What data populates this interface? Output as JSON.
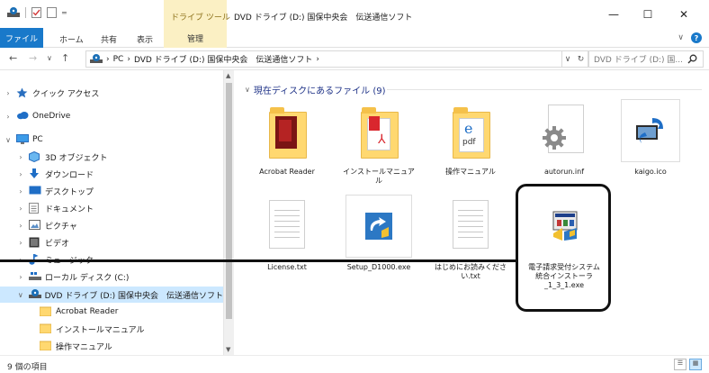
{
  "titlebar": {
    "context_tab_label": "ドライブ ツール",
    "window_title": "DVD ドライブ (D:) 国保中央会　伝送通信ソフト",
    "minimize": "—",
    "maximize": "☐",
    "close": "✕"
  },
  "ribbon": {
    "file_label": "ファイル",
    "home_label": "ホーム",
    "share_label": "共有",
    "view_label": "表示",
    "manage_label": "管理",
    "expand_glyph": "∨",
    "help_glyph": "?"
  },
  "address": {
    "back": "←",
    "forward": "→",
    "recent": "∨",
    "up": "↑",
    "crumbs": [
      "PC",
      "DVD ドライブ (D:) 国保中央会　伝送通信ソフト"
    ],
    "sep": "›",
    "dropdown": "∨",
    "refresh": "↻",
    "search_placeholder": "DVD ドライブ (D:) 国..."
  },
  "nav": {
    "items": [
      {
        "label": "クイック アクセス",
        "chevron": "›",
        "icon": "star-icon"
      },
      {
        "label": "OneDrive",
        "chevron": "›",
        "icon": "cloud-icon"
      },
      {
        "label": "PC",
        "chevron": "∨",
        "icon": "computer-icon"
      },
      {
        "label": "3D オブジェクト",
        "chevron": "›",
        "icon": "cube-icon"
      },
      {
        "label": "ダウンロード",
        "chevron": "›",
        "icon": "download-icon"
      },
      {
        "label": "デスクトップ",
        "chevron": "›",
        "icon": "desktop-icon"
      },
      {
        "label": "ドキュメント",
        "chevron": "›",
        "icon": "document-icon"
      },
      {
        "label": "ピクチャ",
        "chevron": "›",
        "icon": "picture-icon"
      },
      {
        "label": "ビデオ",
        "chevron": "›",
        "icon": "video-icon"
      },
      {
        "label": "ミュージック",
        "chevron": "›",
        "icon": "music-icon"
      },
      {
        "label": "ローカル ディスク (C:)",
        "chevron": "›",
        "icon": "disk-icon"
      },
      {
        "label": "DVD ドライブ (D:) 国保中央会　伝送通信ソフト",
        "chevron": "∨",
        "icon": "dvd-icon"
      },
      {
        "label": "Acrobat Reader",
        "chevron": "",
        "icon": "folder-icon"
      },
      {
        "label": "インストールマニュアル",
        "chevron": "",
        "icon": "folder-icon"
      },
      {
        "label": "操作マニュアル",
        "chevron": "",
        "icon": "folder-icon"
      }
    ]
  },
  "content": {
    "group_label": "現在ディスクにあるファイル (9)",
    "files": [
      {
        "label": "Acrobat Reader",
        "kind": "folder"
      },
      {
        "label": "インストールマニュアル",
        "kind": "folder"
      },
      {
        "label": "操作マニュアル",
        "kind": "folder"
      },
      {
        "label": "autorun.inf",
        "kind": "settings"
      },
      {
        "label": "kaigo.ico",
        "kind": "icon"
      },
      {
        "label": "License.txt",
        "kind": "text"
      },
      {
        "label": "Setup_D1000.exe",
        "kind": "exe"
      },
      {
        "label": "はじめにお読みください.txt",
        "kind": "text"
      },
      {
        "label": "電子請求受付システム 統合インストーラ_1_3_1.exe",
        "kind": "installer"
      }
    ]
  },
  "status": {
    "item_count": "9 個の項目"
  },
  "colors": {
    "accent": "#1979ca",
    "context_tab": "#fbf0c4",
    "selection": "#cce8ff",
    "folder": "#ffd870"
  }
}
